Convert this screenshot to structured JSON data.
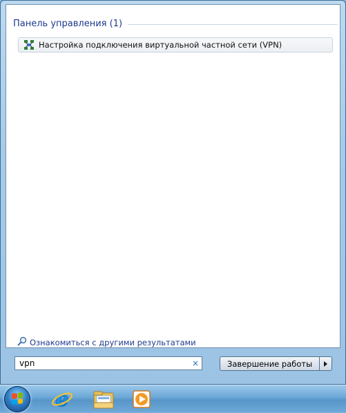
{
  "search_results": {
    "section_title": "Панель управления (1)",
    "items": [
      {
        "label": "Настройка подключения виртуальной частной сети (VPN)",
        "icon": "vpn-network-icon"
      }
    ],
    "more_results_label": "Ознакомиться с другими результатами"
  },
  "search": {
    "value": "vpn",
    "clear_glyph": "×"
  },
  "shutdown": {
    "label": "Завершение работы"
  },
  "taskbar": {
    "pinned": [
      "internet-explorer-icon",
      "windows-explorer-icon",
      "windows-media-player-icon"
    ]
  },
  "colors": {
    "accent_text": "#1d3a8c",
    "taskbar": "#5795c9"
  }
}
